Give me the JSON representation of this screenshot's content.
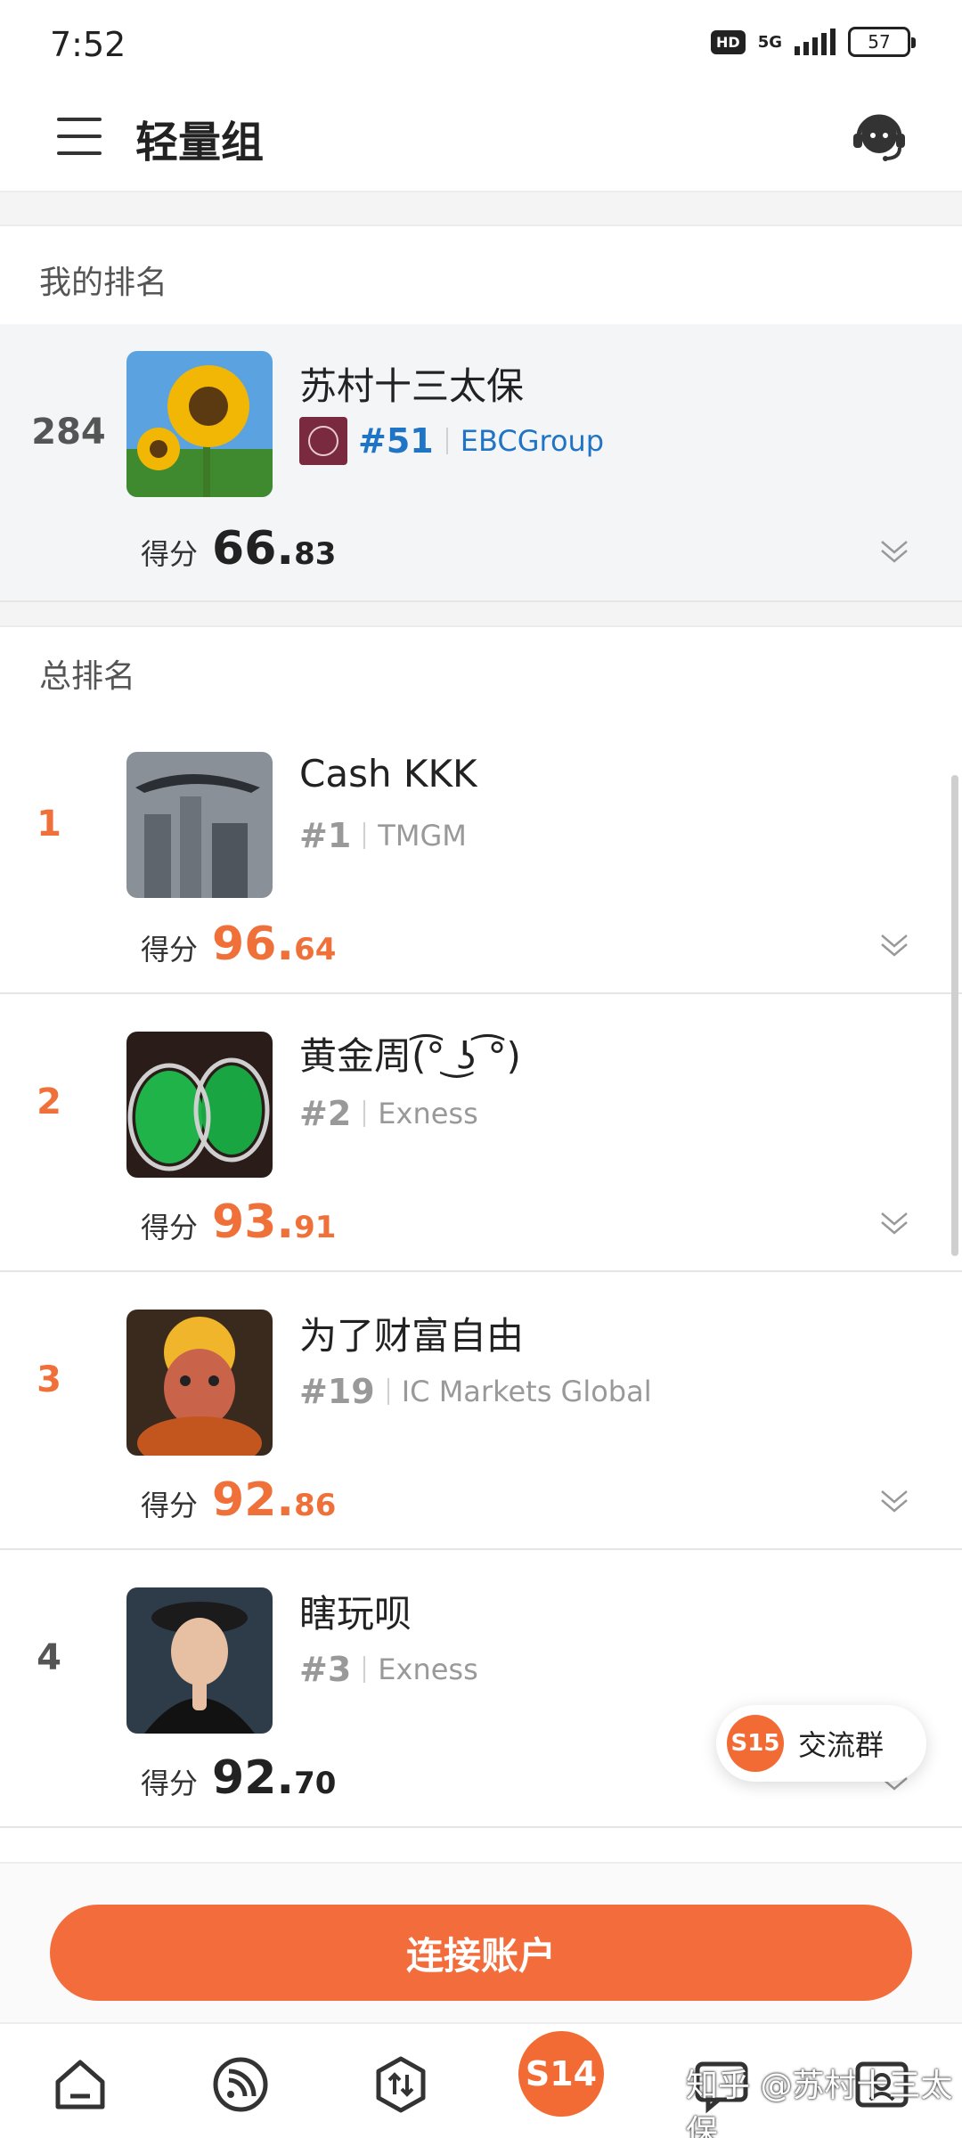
{
  "status_bar": {
    "time": "7:52",
    "hd": "HD",
    "network": "5G",
    "battery": "57"
  },
  "header": {
    "title": "轻量组",
    "menu_icon": "menu-icon",
    "support_icon": "headset-icon"
  },
  "my_ranking": {
    "section_label": "我的排名",
    "rank": "284",
    "name": "苏村十三太保",
    "broker_rank": "#51",
    "broker": "EBCGroup",
    "score_label": "得分",
    "score_int": "66.",
    "score_dec": "83"
  },
  "overall_ranking": {
    "section_label": "总排名",
    "entries": [
      {
        "rank": "1",
        "name": "Cash KKK",
        "broker_rank": "#1",
        "broker": "TMGM",
        "score_label": "得分",
        "score_int": "96.",
        "score_dec": "64"
      },
      {
        "rank": "2",
        "name": "黄金周(͡° ͜ʖ ͡°)",
        "broker_rank": "#2",
        "broker": "Exness",
        "score_label": "得分",
        "score_int": "93.",
        "score_dec": "91"
      },
      {
        "rank": "3",
        "name": "为了财富自由",
        "broker_rank": "#19",
        "broker": "IC Markets Global",
        "score_label": "得分",
        "score_int": "92.",
        "score_dec": "86"
      },
      {
        "rank": "4",
        "name": "瞎玩呗",
        "broker_rank": "#3",
        "broker": "Exness",
        "score_label": "得分",
        "score_int": "92.",
        "score_dec": "70"
      }
    ]
  },
  "float_chat": {
    "badge": "S15",
    "label": "交流群"
  },
  "connect_button": {
    "label": "连接账户"
  },
  "tab_bar": {
    "center_badge": "S14",
    "watermark": "知乎 @苏村十三太保"
  },
  "colors": {
    "accent": "#f26d3b",
    "link_blue": "#1f74c6",
    "rank_orange": "#f0703a"
  }
}
